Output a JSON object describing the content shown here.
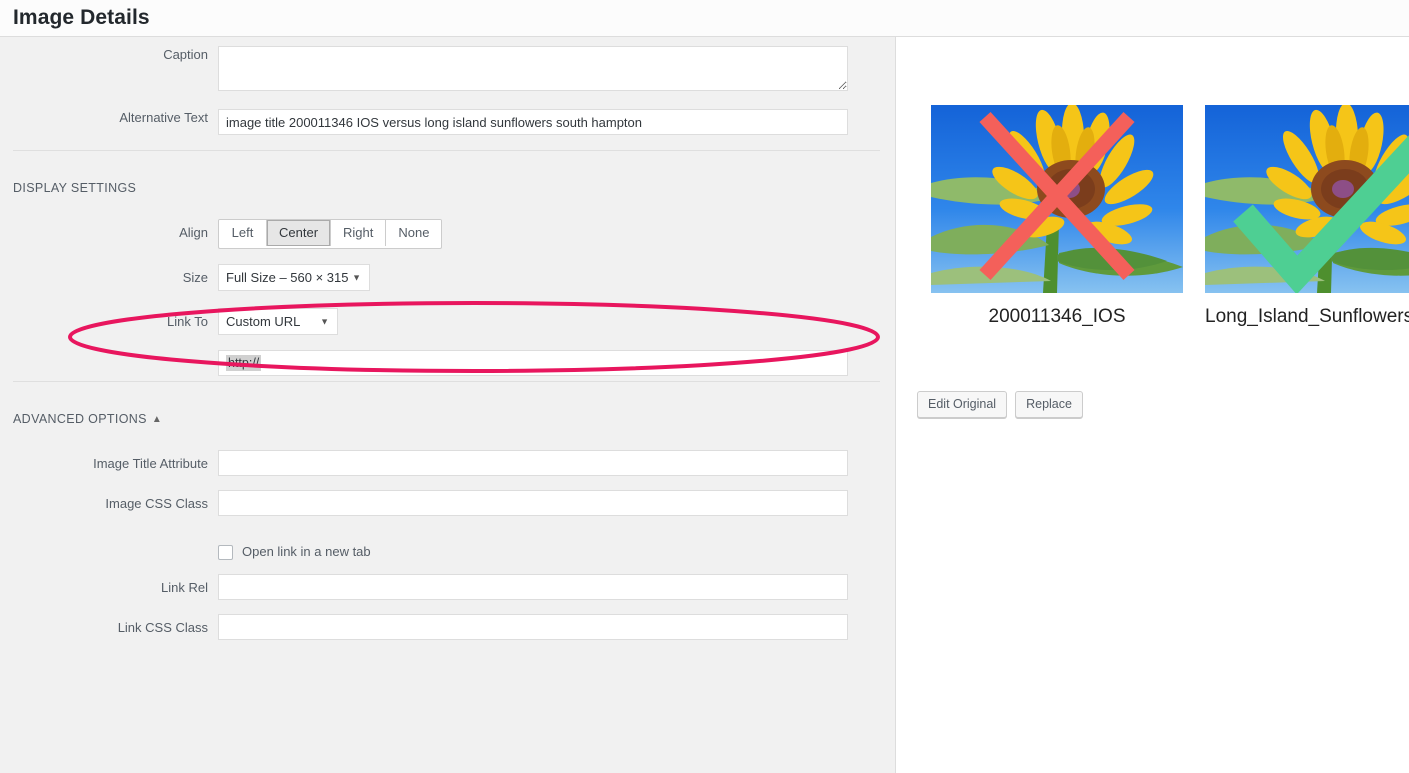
{
  "window": {
    "title": "Image Details"
  },
  "form": {
    "caption": {
      "label": "Caption",
      "value": "",
      "placeholder": ""
    },
    "alt_text": {
      "label": "Alternative Text",
      "value": "image title 200011346 IOS versus long island sunflowers south hampton",
      "placeholder": ""
    }
  },
  "display_settings": {
    "heading": "DISPLAY SETTINGS",
    "align": {
      "label": "Align",
      "options": [
        "Left",
        "Center",
        "Right",
        "None"
      ],
      "selected": "Center"
    },
    "size": {
      "label": "Size",
      "selected": "Full Size – 560 × 315",
      "arrow": "▼"
    },
    "link_to": {
      "label": "Link To",
      "selected": "Custom URL",
      "arrow": "▼",
      "url_value": "http://",
      "url_selected": true
    }
  },
  "advanced_options": {
    "heading": "ADVANCED OPTIONS",
    "caret": "▲",
    "image_title_attribute": {
      "label": "Image Title Attribute",
      "value": ""
    },
    "image_css_class": {
      "label": "Image CSS Class",
      "value": ""
    },
    "open_new_tab": {
      "label": "Open link in a new tab",
      "checked": false
    },
    "link_rel": {
      "label": "Link Rel",
      "value": ""
    },
    "link_css_class": {
      "label": "Link CSS Class",
      "value": ""
    }
  },
  "preview": {
    "thumbnails": [
      {
        "caption": "200011346_IOS",
        "marker": "x-mark",
        "marker_color": "#f4605a"
      },
      {
        "caption": "Long_Island_Sunflowers_South_Hampton",
        "marker": "check-mark",
        "marker_color": "#4ecf93"
      }
    ],
    "buttons": [
      {
        "label": "Edit Original"
      },
      {
        "label": "Replace"
      }
    ]
  },
  "annotation": {
    "shape": "ellipse",
    "color": "#e8165e",
    "target": "Link To custom URL field"
  },
  "colors": {
    "panel_background": "#f1f1f1",
    "preview_background": "#ffffff",
    "titlebar_background": "#fcfcfc",
    "label_text": "#555d66",
    "annotation_red": "#e8165e",
    "x_mark": "#f4605a",
    "check_mark": "#4ecf93",
    "sky_blue": "#1769d8",
    "petal_yellow": "#f2c519"
  }
}
